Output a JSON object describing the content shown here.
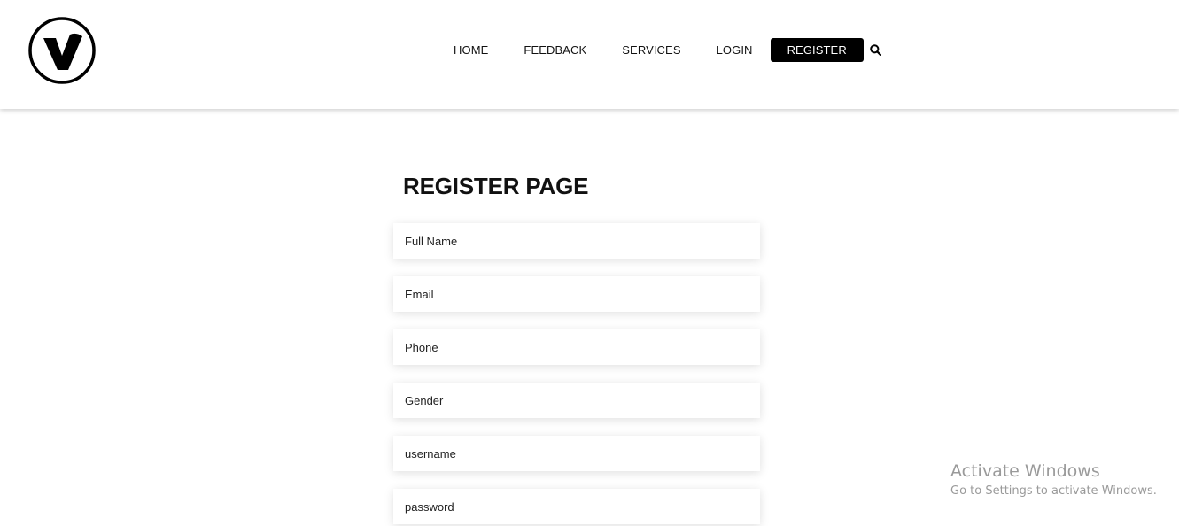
{
  "header": {
    "logo_icon": "v-circle-logo",
    "nav": {
      "home": "HOME",
      "feedback": "FEEDBACK",
      "services": "SERVICES",
      "login": "LOGIN",
      "register": "REGISTER"
    },
    "search_icon": "search-icon",
    "active_color": "#000000"
  },
  "main": {
    "title": "REGISTER PAGE",
    "fields": {
      "full_name": {
        "placeholder": "Full Name",
        "value": ""
      },
      "email": {
        "placeholder": "Email",
        "value": ""
      },
      "phone": {
        "placeholder": "Phone",
        "value": ""
      },
      "gender": {
        "placeholder": "Gender",
        "value": ""
      },
      "username": {
        "placeholder": "username",
        "value": ""
      },
      "password": {
        "placeholder": "password",
        "value": ""
      }
    }
  },
  "watermark": {
    "title": "Activate Windows",
    "subtitle": "Go to Settings to activate Windows."
  }
}
